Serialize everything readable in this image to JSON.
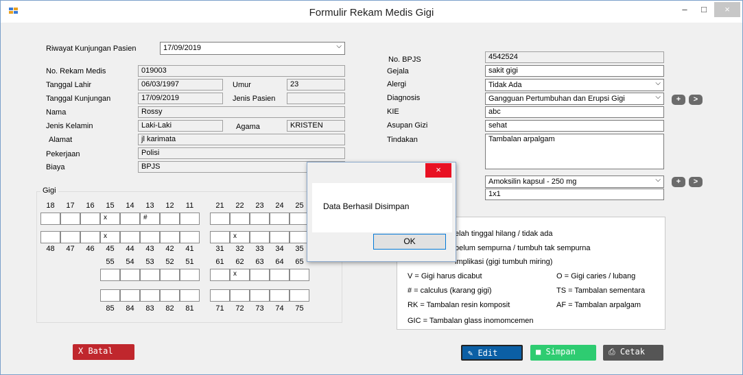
{
  "window": {
    "title": "Formulir Rekam Medis Gigi",
    "minimize": "–",
    "maximize": "□",
    "close": "×"
  },
  "left": {
    "riwayat_label": "Riwayat Kunjungan Pasien",
    "riwayat_value": "17/09/2019",
    "no_rm_label": "No. Rekam Medis",
    "no_rm": "019003",
    "tgl_lahir_label": "Tanggal Lahir",
    "tgl_lahir": "06/03/1997",
    "umur_label": "Umur",
    "umur": "23",
    "tgl_kunjungan_label": "Tanggal Kunjungan",
    "tgl_kunjungan": "17/09/2019",
    "jenis_pasien_label": "Jenis Pasien",
    "jenis_pasien": "",
    "nama_label": "Nama",
    "nama": "Rossy",
    "jk_label": "Jenis Kelamin",
    "jk": "Laki-Laki",
    "agama_label": "Agama",
    "agama": "KRISTEN",
    "alamat_label": "Alamat",
    "alamat": "jl karimata",
    "pekerjaan_label": "Pekerjaan",
    "pekerjaan": "Polisi",
    "biaya_label": "Biaya",
    "biaya": "BPJS"
  },
  "right": {
    "bpjs_label": "No. BPJS",
    "bpjs": "4542524",
    "gejala_label": "Gejala",
    "gejala": "sakit gigi",
    "alergi_label": "Alergi",
    "alergi": "Tidak Ada",
    "diagnosis_label": "Diagnosis",
    "diagnosis": "Gangguan Pertumbuhan dan Erupsi Gigi",
    "kie_label": "KIE",
    "kie": "abc",
    "gizi_label": "Asupan Gizi",
    "gizi": "sehat",
    "tindakan_label": "Tindakan",
    "tindakan": "Tambalan arpalgam",
    "obat": "Amoksilin kapsul - 250 mg",
    "dosis": "1x1"
  },
  "gigi": {
    "title": "Gigi",
    "upper_nums_left": [
      "18",
      "17",
      "16",
      "15",
      "14",
      "13",
      "12",
      "11"
    ],
    "upper_nums_right": [
      "21",
      "22",
      "23",
      "24",
      "25"
    ],
    "upper_marks_left": [
      "",
      "",
      "",
      "x",
      "",
      "#",
      "",
      ""
    ],
    "upper_marks_right": [
      "",
      "",
      "",
      "",
      ""
    ],
    "mid_marks_left": [
      "",
      "",
      "",
      "x",
      "",
      "",
      "",
      ""
    ],
    "mid_marks_right": [
      "",
      "x",
      "",
      "",
      ""
    ],
    "lower_nums_left": [
      "48",
      "47",
      "46",
      "45",
      "44",
      "43",
      "42",
      "41"
    ],
    "lower_nums_right": [
      "31",
      "32",
      "33",
      "34",
      "35"
    ],
    "primary_upper_left": [
      "55",
      "54",
      "53",
      "52",
      "51"
    ],
    "primary_upper_right": [
      "61",
      "62",
      "63",
      "64",
      "65"
    ],
    "p_marks1_left": [
      "",
      "",
      "",
      "",
      ""
    ],
    "p_marks1_right": [
      "",
      "x",
      "",
      "",
      ""
    ],
    "p_marks2_left": [
      "",
      "",
      "",
      "",
      ""
    ],
    "p_marks2_right": [
      "",
      "",
      "",
      "",
      ""
    ],
    "primary_lower_left": [
      "85",
      "84",
      "83",
      "82",
      "81"
    ],
    "primary_lower_right": [
      "71",
      "72",
      "73",
      "74",
      "75"
    ]
  },
  "legend": {
    "l1": "elah tinggal hilang / tidak ada",
    "l2": "belum sempurna / tumbuh tak sempurna",
    "l3": "implikasi (gigi tumbuh miring)",
    "l4": "V    = Gigi harus dicabut",
    "l5": "O    = Gigi caries / lubang",
    "l6": "#    = calculus (karang gigi)",
    "l7": "TS  = Tambalan sementara",
    "l8": "RK = Tambalan resin komposit",
    "l9": "AF  = Tambalan arpalgam",
    "l10": "GIC = Tambalan glass inomomcemen"
  },
  "buttons": {
    "batal": "X Batal",
    "edit": "Edit",
    "simpan": "Simpan",
    "cetak": "Cetak",
    "plus": "+",
    "next": ">"
  },
  "dialog": {
    "message": "Data Berhasil Disimpan",
    "ok": "OK",
    "close": "×"
  },
  "colors": {
    "batal": "#c0272d",
    "edit": "#0b5fa5",
    "simpan": "#2ecc71",
    "cetak": "#555555"
  }
}
